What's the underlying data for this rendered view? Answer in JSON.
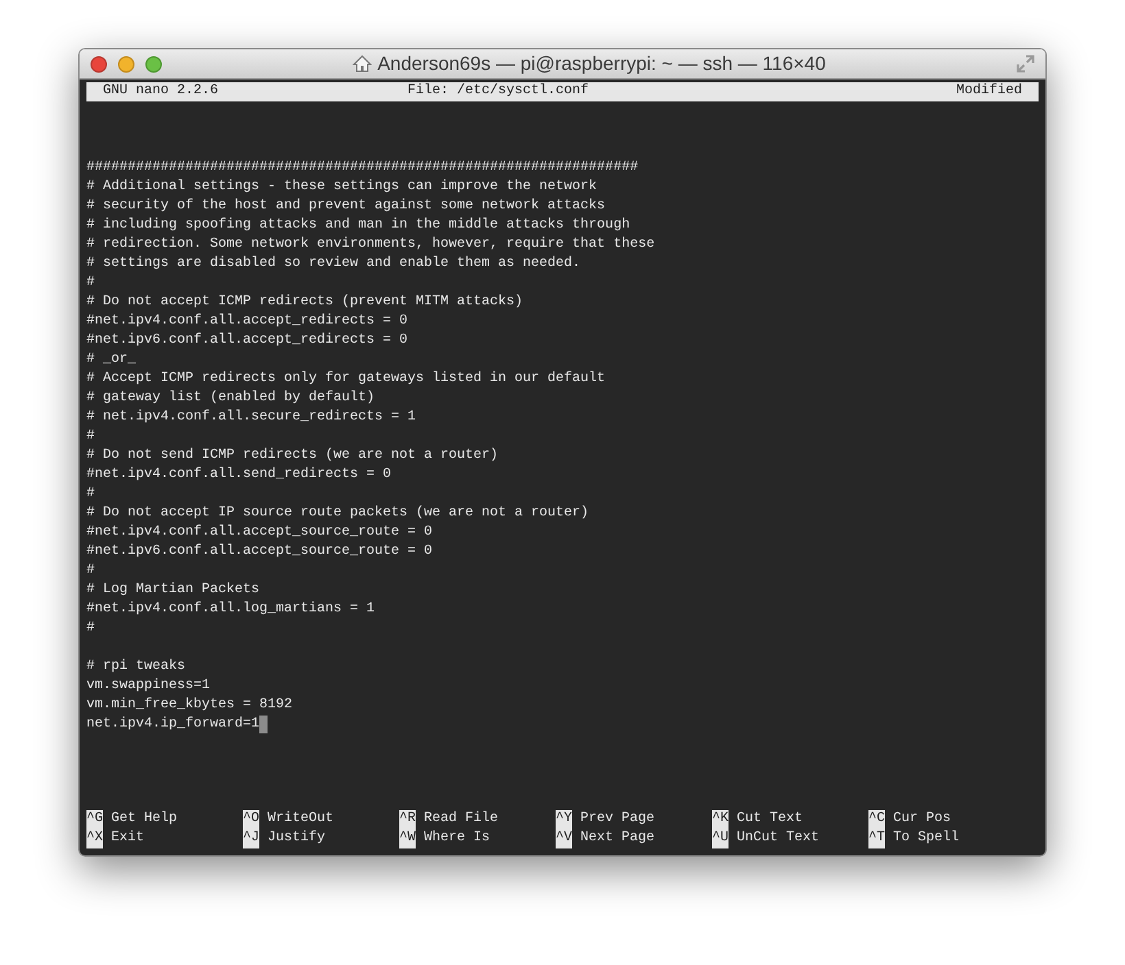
{
  "window": {
    "title": "Anderson69s — pi@raspberrypi: ~ — ssh — 116×40"
  },
  "header": {
    "version": "GNU nano 2.2.6",
    "file": "File: /etc/sysctl.conf",
    "status": "Modified"
  },
  "lines": [
    {
      "kind": "blank"
    },
    {
      "kind": "blank"
    },
    {
      "kind": "blank"
    },
    {
      "kind": "text",
      "text": "###################################################################"
    },
    {
      "kind": "text",
      "text": "# Additional settings - these settings can improve the network"
    },
    {
      "kind": "text",
      "text": "# security of the host and prevent against some network attacks"
    },
    {
      "kind": "text",
      "text": "# including spoofing attacks and man in the middle attacks through"
    },
    {
      "kind": "text",
      "text": "# redirection. Some network environments, however, require that these"
    },
    {
      "kind": "text",
      "text": "# settings are disabled so review and enable them as needed."
    },
    {
      "kind": "text",
      "text": "#"
    },
    {
      "kind": "text",
      "text": "# Do not accept ICMP redirects (prevent MITM attacks)"
    },
    {
      "kind": "text",
      "text": "#net.ipv4.conf.all.accept_redirects = 0"
    },
    {
      "kind": "text",
      "text": "#net.ipv6.conf.all.accept_redirects = 0"
    },
    {
      "kind": "text",
      "text": "# _or_"
    },
    {
      "kind": "text",
      "text": "# Accept ICMP redirects only for gateways listed in our default"
    },
    {
      "kind": "text",
      "text": "# gateway list (enabled by default)"
    },
    {
      "kind": "text",
      "text": "# net.ipv4.conf.all.secure_redirects = 1"
    },
    {
      "kind": "text",
      "text": "#"
    },
    {
      "kind": "text",
      "text": "# Do not send ICMP redirects (we are not a router)"
    },
    {
      "kind": "text",
      "text": "#net.ipv4.conf.all.send_redirects = 0"
    },
    {
      "kind": "text",
      "text": "#"
    },
    {
      "kind": "text",
      "text": "# Do not accept IP source route packets (we are not a router)"
    },
    {
      "kind": "text",
      "text": "#net.ipv4.conf.all.accept_source_route = 0"
    },
    {
      "kind": "text",
      "text": "#net.ipv6.conf.all.accept_source_route = 0"
    },
    {
      "kind": "text",
      "text": "#"
    },
    {
      "kind": "text",
      "text": "# Log Martian Packets"
    },
    {
      "kind": "text",
      "text": "#net.ipv4.conf.all.log_martians = 1"
    },
    {
      "kind": "text",
      "text": "#"
    },
    {
      "kind": "blank"
    },
    {
      "kind": "text",
      "text": "# rpi tweaks"
    },
    {
      "kind": "text",
      "text": "vm.swappiness=1"
    },
    {
      "kind": "text",
      "text": "vm.min_free_kbytes = 8192"
    },
    {
      "kind": "text",
      "text": "net.ipv4.ip_forward=1",
      "cursor": true
    }
  ],
  "shortcuts": [
    {
      "key": "^G",
      "label": "Get Help"
    },
    {
      "key": "^O",
      "label": "WriteOut"
    },
    {
      "key": "^R",
      "label": "Read File"
    },
    {
      "key": "^Y",
      "label": "Prev Page"
    },
    {
      "key": "^K",
      "label": "Cut Text"
    },
    {
      "key": "^C",
      "label": "Cur Pos"
    },
    {
      "key": "^X",
      "label": "Exit"
    },
    {
      "key": "^J",
      "label": "Justify"
    },
    {
      "key": "^W",
      "label": "Where Is"
    },
    {
      "key": "^V",
      "label": "Next Page"
    },
    {
      "key": "^U",
      "label": "UnCut Text"
    },
    {
      "key": "^T",
      "label": "To Spell"
    }
  ]
}
